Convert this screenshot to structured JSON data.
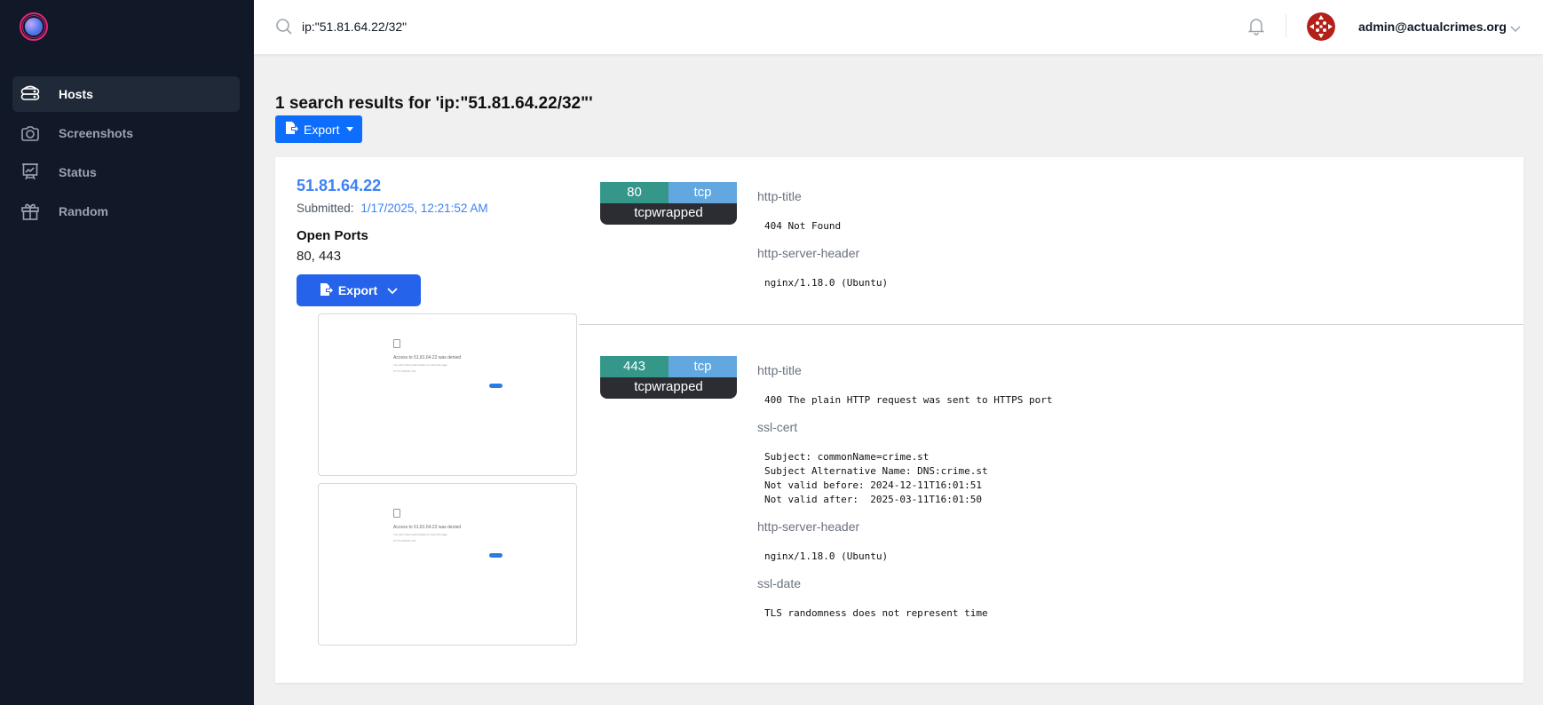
{
  "sidebar": {
    "logo": "ivre-logo",
    "items": [
      {
        "label": "Hosts",
        "icon": "server-stack-icon",
        "active": true
      },
      {
        "label": "Screenshots",
        "icon": "camera-icon",
        "active": false
      },
      {
        "label": "Status",
        "icon": "presentation-chart-icon",
        "active": false
      },
      {
        "label": "Random",
        "icon": "gift-icon",
        "active": false
      }
    ]
  },
  "topbar": {
    "search_value": "ip:\"51.81.64.22/32\"",
    "user_email": "admin@actualcrimes.org"
  },
  "main": {
    "results_title": "1 search results for 'ip:\"51.81.64.22/32\"'",
    "export_label": "Export"
  },
  "host": {
    "ip": "51.81.64.22",
    "submitted_label": "Submitted:",
    "submitted_date": "1/17/2025, 12:21:52 AM",
    "open_ports_label": "Open Ports",
    "open_ports_value": "80, 443",
    "export_label": "Export",
    "screenshots": [
      {
        "title": "Access to 51.81.64.22 was denied",
        "line1": "You don't have authorization to view this page.",
        "line2": "HTTP ERROR 403"
      },
      {
        "title": "Access to 51.81.64.22 was denied",
        "line1": "You don't have authorization to view this page.",
        "line2": "HTTP ERROR 403"
      }
    ],
    "ports": [
      {
        "port": "80",
        "protocol": "tcp",
        "service": "tcpwrapped",
        "scripts": [
          {
            "name": "http-title",
            "output": "404 Not Found"
          },
          {
            "name": "http-server-header",
            "output": "nginx/1.18.0 (Ubuntu)"
          }
        ]
      },
      {
        "port": "443",
        "protocol": "tcp",
        "service": "tcpwrapped",
        "scripts": [
          {
            "name": "http-title",
            "output": "400 The plain HTTP request was sent to HTTPS port"
          },
          {
            "name": "ssl-cert",
            "output": "Subject: commonName=crime.st\nSubject Alternative Name: DNS:crime.st\nNot valid before: 2024-12-11T16:01:51\nNot valid after:  2025-03-11T16:01:50"
          },
          {
            "name": "http-server-header",
            "output": "nginx/1.18.0 (Ubuntu)"
          },
          {
            "name": "ssl-date",
            "output": "TLS randomness does not represent time"
          }
        ]
      }
    ]
  },
  "colors": {
    "sidebar_bg": "#111827",
    "link_blue": "#3b82f6",
    "port_num": "#35968a",
    "port_proto": "#62a7df",
    "port_service": "#2b2d33",
    "export_primary": "#0d6efd",
    "export_host": "#2563eb"
  }
}
